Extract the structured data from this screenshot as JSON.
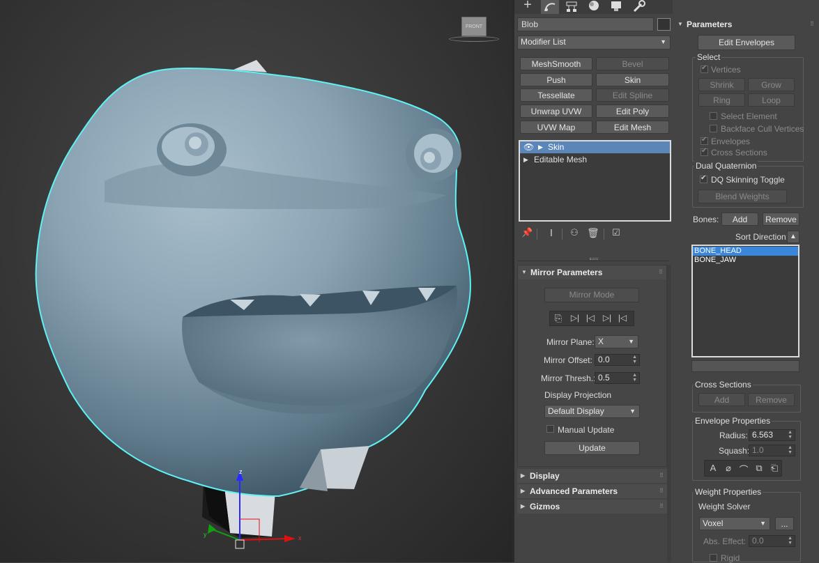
{
  "object_name": "Blob",
  "modifier_list": "Modifier List",
  "viewcube_label": "FRONT",
  "gizmo_axes": {
    "x": "x",
    "y": "y",
    "z": "z"
  },
  "tab_icons": [
    "create-icon",
    "modify-icon",
    "hierarchy-icon",
    "motion-icon",
    "display-icon",
    "utilities-icon"
  ],
  "modifier_buttons": [
    {
      "label": "MeshSmooth",
      "enabled": true
    },
    {
      "label": "Bevel",
      "enabled": false
    },
    {
      "label": "Push",
      "enabled": true
    },
    {
      "label": "Skin",
      "enabled": true
    },
    {
      "label": "Tessellate",
      "enabled": true
    },
    {
      "label": "Edit Spline",
      "enabled": false
    },
    {
      "label": "Unwrap UVW",
      "enabled": true
    },
    {
      "label": "Edit Poly",
      "enabled": true
    },
    {
      "label": "UVW Map",
      "enabled": true
    },
    {
      "label": "Edit Mesh",
      "enabled": true
    }
  ],
  "stack": [
    {
      "label": "Skin",
      "selected": true
    },
    {
      "label": "Editable Mesh",
      "selected": false
    }
  ],
  "mirror": {
    "title": "Mirror Parameters",
    "mode_button": "Mirror Mode",
    "plane_label": "Mirror Plane:",
    "plane_value": "X",
    "offset_label": "Mirror Offset:",
    "offset_value": "0.0",
    "thresh_label": "Mirror Thresh.:",
    "thresh_value": "0.5",
    "projection_label": "Display Projection",
    "projection_value": "Default Display",
    "manual_update_label": "Manual Update",
    "update_button": "Update"
  },
  "rollouts": {
    "display": "Display",
    "advanced": "Advanced Parameters",
    "gizmos": "Gizmos"
  },
  "params": {
    "title": "Parameters",
    "edit_envelopes": "Edit Envelopes",
    "select_group": "Select",
    "vertices": "Vertices",
    "shrink": "Shrink",
    "grow": "Grow",
    "ring": "Ring",
    "loop": "Loop",
    "select_element": "Select Element",
    "backface": "Backface Cull Vertices",
    "envelopes": "Envelopes",
    "cross_sections": "Cross Sections",
    "dq_group": "Dual Quaternion",
    "dq_toggle": "DQ Skinning Toggle",
    "blend_weights": "Blend Weights",
    "bones_label": "Bones:",
    "add": "Add",
    "remove": "Remove",
    "sort_direction": "Sort Direction:",
    "bones": [
      "BONE_HEAD",
      "BONE_JAW"
    ],
    "cross_group": "Cross Sections",
    "cs_add": "Add",
    "cs_remove": "Remove",
    "envprop_group": "Envelope Properties",
    "radius_label": "Radius:",
    "radius_value": "6.563",
    "squash_label": "Squash:",
    "squash_value": "1.0",
    "weight_group": "Weight Properties",
    "weight_solver": "Weight Solver",
    "solver_value": "Voxel",
    "solver_more": "...",
    "abs_effect_label": "Abs. Effect:",
    "abs_effect_value": "0.0",
    "rigid": "Rigid"
  }
}
